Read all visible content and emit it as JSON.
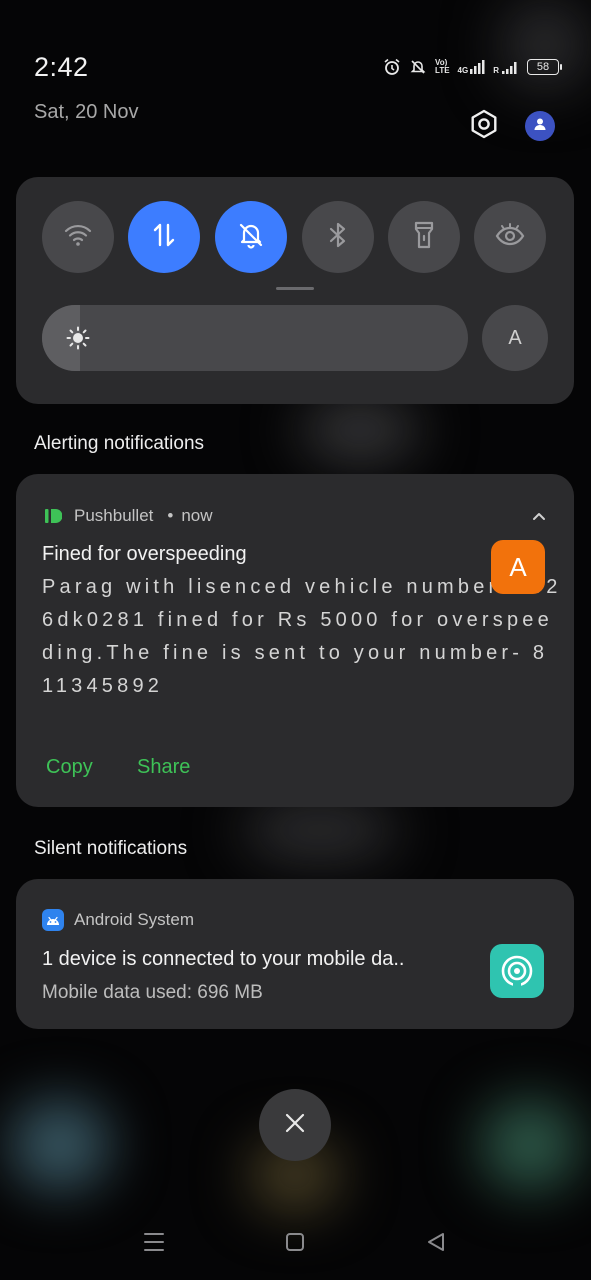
{
  "status_bar": {
    "time": "2:42",
    "date": "Sat, 20 Nov",
    "volte_label": "Vo)\nLTE",
    "network_label": "4G",
    "roaming_label": "R",
    "battery_level": "58"
  },
  "quick_settings": {
    "tiles": [
      {
        "name": "wifi",
        "icon": "wifi-icon",
        "active": false
      },
      {
        "name": "mobile-data",
        "icon": "data-arrows-icon",
        "active": true
      },
      {
        "name": "silent",
        "icon": "bell-off-icon",
        "active": true
      },
      {
        "name": "bluetooth",
        "icon": "bluetooth-icon",
        "active": false
      },
      {
        "name": "flashlight",
        "icon": "flashlight-icon",
        "active": false
      },
      {
        "name": "eye-comfort",
        "icon": "eye-icon",
        "active": false
      }
    ],
    "brightness_level": 0.09,
    "auto_brightness_label": "A"
  },
  "alerting": {
    "section_title": "Alerting notifications",
    "notification": {
      "app_name": "Pushbullet",
      "separator": "•",
      "time": "now",
      "title": "Fined for overspeeding",
      "body": "Parag with lisenced vehicle number- hr26dk0281 fined for Rs 5000 for overspeeding.The fine is sent to your number- 811345892",
      "avatar_letter": "A",
      "actions": [
        "Copy",
        "Share"
      ]
    }
  },
  "silent": {
    "section_title": "Silent notifications",
    "notification": {
      "app_name": "Android System",
      "title": "1 device is connected to your mobile da..",
      "subtitle": "Mobile data used: 696 MB"
    }
  },
  "colors": {
    "background": "#050506",
    "panel": "#2b2b2d",
    "tile_inactive": "#48484b",
    "tile_active": "#3d7dff",
    "action_green": "#3ec257",
    "avatar_orange": "#f2720c",
    "hotspot_teal": "#2fc4b0"
  }
}
